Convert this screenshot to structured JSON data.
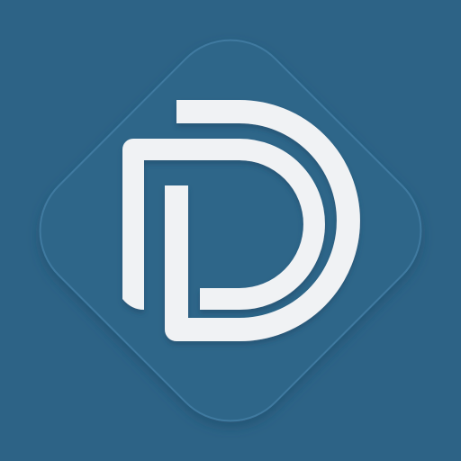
{
  "icon": {
    "name": "d-monogram-logo",
    "colors": {
      "background": "#2d6386",
      "tile": "#2f6689",
      "tile_border": "#3f7aa0",
      "tile_shadow": "#235070",
      "glyph": "#f0f2f4",
      "glyph_shadow": "#1d4a66"
    }
  }
}
